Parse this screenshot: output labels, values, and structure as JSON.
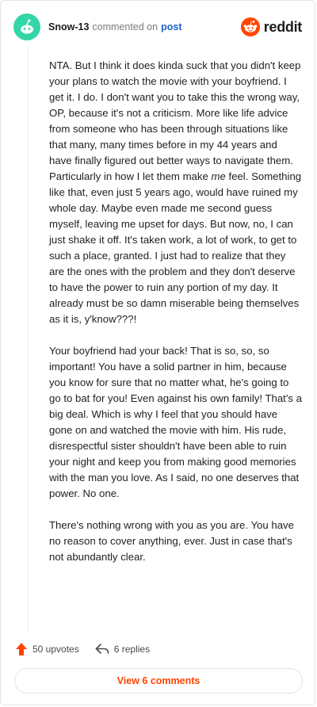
{
  "header": {
    "username": "Snow-13",
    "commented_text": "commented on",
    "post_link": "post",
    "brand": "reddit"
  },
  "comment": {
    "paragraphs": [
      "NTA. But I think it does kinda suck that you didn't keep your plans to watch the movie with your boyfriend. I get it. I do. I don't want you to take this the wrong way, OP, because it's not a criticism. More like life advice from someone who has been through situations like that many, many times before in my 44 years and have finally figured out better ways to navigate them. Particularly in how I let them make me feel. Something like that, even just 5 years ago, would have ruined my whole day. Maybe even made me second guess myself, leaving me upset for days. But now, no, I can just shake it off. It's taken work, a lot of work, to get to such a place, granted. I just had to realize that they are the ones with the problem and they don't deserve to have the power to ruin any portion of my day. It already must be so damn miserable being themselves as it is, y'know???!",
      "Your boyfriend had your back! That is so, so, so important! You have a solid partner in him, because you know for sure that no matter what, he's going to go to bat for you! Even against his own family! That's a big deal. Which is why I feel that you should have gone on and watched the movie with him. His rude, disrespectful sister shouldn't have been able to ruin your night and keep you from making good memories with the man you love. As I said, no one deserves that power. No one.",
      "There's nothing wrong with you as you are. You have no reason to cover anything, ever. Just in case that's not abundantly clear."
    ]
  },
  "actions": {
    "upvotes": "50 upvotes",
    "replies": "6 replies"
  },
  "view_comments": "View 6 comments",
  "colors": {
    "avatar": "#33d6a6",
    "reddit_orange": "#ff4500",
    "link_blue": "#1a64c8"
  },
  "icons": [
    "snoo-avatar-icon",
    "reddit-logo-icon",
    "upvote-arrow-icon",
    "reply-arrow-icon"
  ]
}
